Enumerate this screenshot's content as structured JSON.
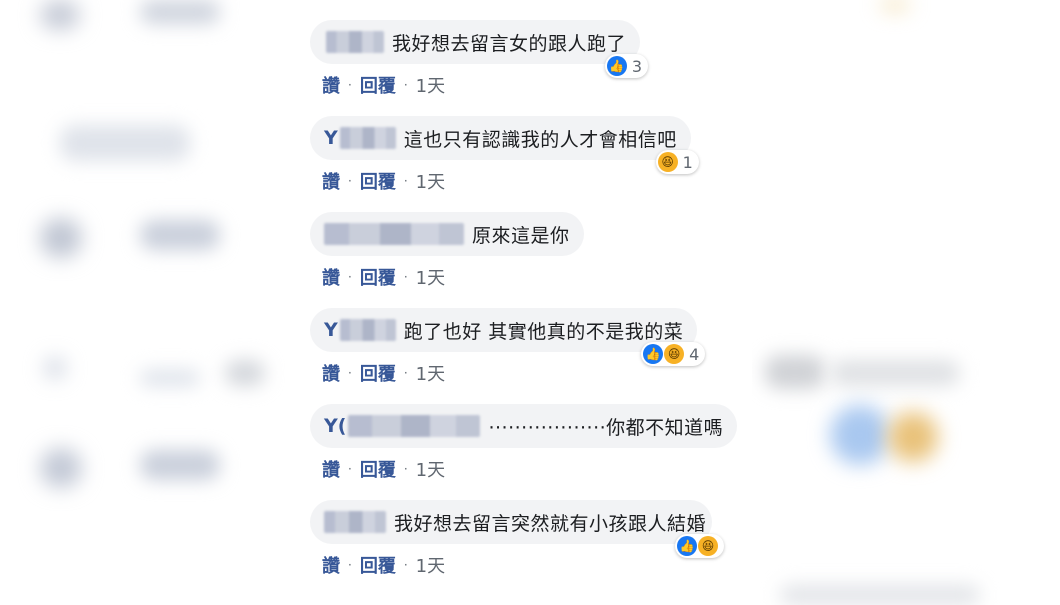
{
  "comments": [
    {
      "initial": "",
      "name_width": 58,
      "text": "我好想去留言女的跟人跑了",
      "reaction_count": "3",
      "reactions": [
        "like-icon"
      ]
    },
    {
      "initial": "Y",
      "name_width": 56,
      "text": "這也只有認識我的人才會相信吧",
      "reaction_count": "1",
      "reactions": [
        "haha-icon"
      ]
    },
    {
      "initial": "",
      "name_width": 140,
      "text": "原來這是你",
      "reaction_count": "",
      "reactions": []
    },
    {
      "initial": "Y",
      "name_width": 56,
      "text": "跑了也好 其實他真的不是我的菜",
      "reaction_count": "4",
      "reactions": [
        "like-icon",
        "haha-icon"
      ]
    },
    {
      "initial": "Y(",
      "name_width": 132,
      "text": "··················你都不知道嗎",
      "reaction_count": "",
      "reactions": []
    },
    {
      "initial": "",
      "name_width": 62,
      "text": "我好想去留言突然就有小孩跟人結婚",
      "reaction_count": "",
      "reactions": [
        "like-icon",
        "haha-icon"
      ]
    }
  ],
  "actions": {
    "like": "讚",
    "reply": "回覆",
    "time": "1天"
  }
}
